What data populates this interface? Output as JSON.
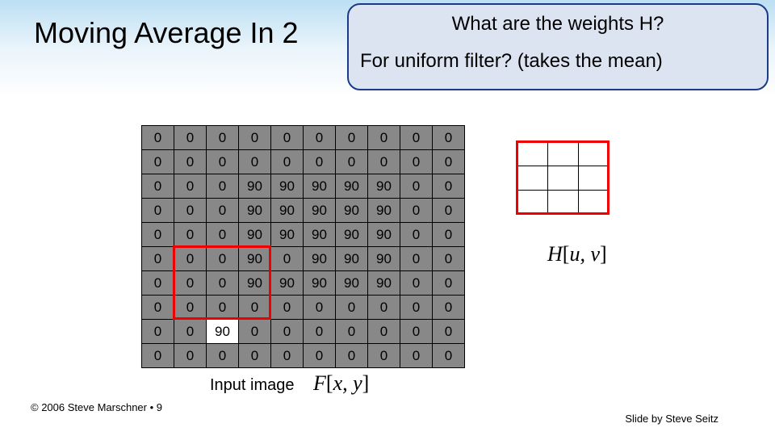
{
  "title": "Moving Average In 2",
  "callout": {
    "line1": "What are the weights H?",
    "line2": "For uniform filter? (takes the mean)"
  },
  "matrix": [
    [
      0,
      0,
      0,
      0,
      0,
      0,
      0,
      0,
      0,
      0
    ],
    [
      0,
      0,
      0,
      0,
      0,
      0,
      0,
      0,
      0,
      0
    ],
    [
      0,
      0,
      0,
      90,
      90,
      90,
      90,
      90,
      0,
      0
    ],
    [
      0,
      0,
      0,
      90,
      90,
      90,
      90,
      90,
      0,
      0
    ],
    [
      0,
      0,
      0,
      90,
      90,
      90,
      90,
      90,
      0,
      0
    ],
    [
      0,
      0,
      0,
      90,
      0,
      90,
      90,
      90,
      0,
      0
    ],
    [
      0,
      0,
      0,
      90,
      90,
      90,
      90,
      90,
      0,
      0
    ],
    [
      0,
      0,
      0,
      0,
      0,
      0,
      0,
      0,
      0,
      0
    ],
    [
      0,
      0,
      90,
      0,
      0,
      0,
      0,
      0,
      0,
      0
    ],
    [
      0,
      0,
      0,
      0,
      0,
      0,
      0,
      0,
      0,
      0
    ]
  ],
  "white_cells": [
    [
      8,
      2
    ]
  ],
  "red_box_matrix": {
    "row_start": 5,
    "row_end": 7,
    "col_start": 1,
    "col_end": 3
  },
  "kernel_size": {
    "rows": 3,
    "cols": 3
  },
  "red_box_kernel": {
    "row_start": 0,
    "row_end": 2,
    "col_start": 0,
    "col_end": 2
  },
  "input_label": "Input image",
  "f_formula": {
    "sym": "F",
    "args": "x, y"
  },
  "h_formula": {
    "sym": "H",
    "args": "u, v"
  },
  "footer_left": "© 2006 Steve Marschner • 9",
  "footer_right": "Slide by Steve Seitz"
}
